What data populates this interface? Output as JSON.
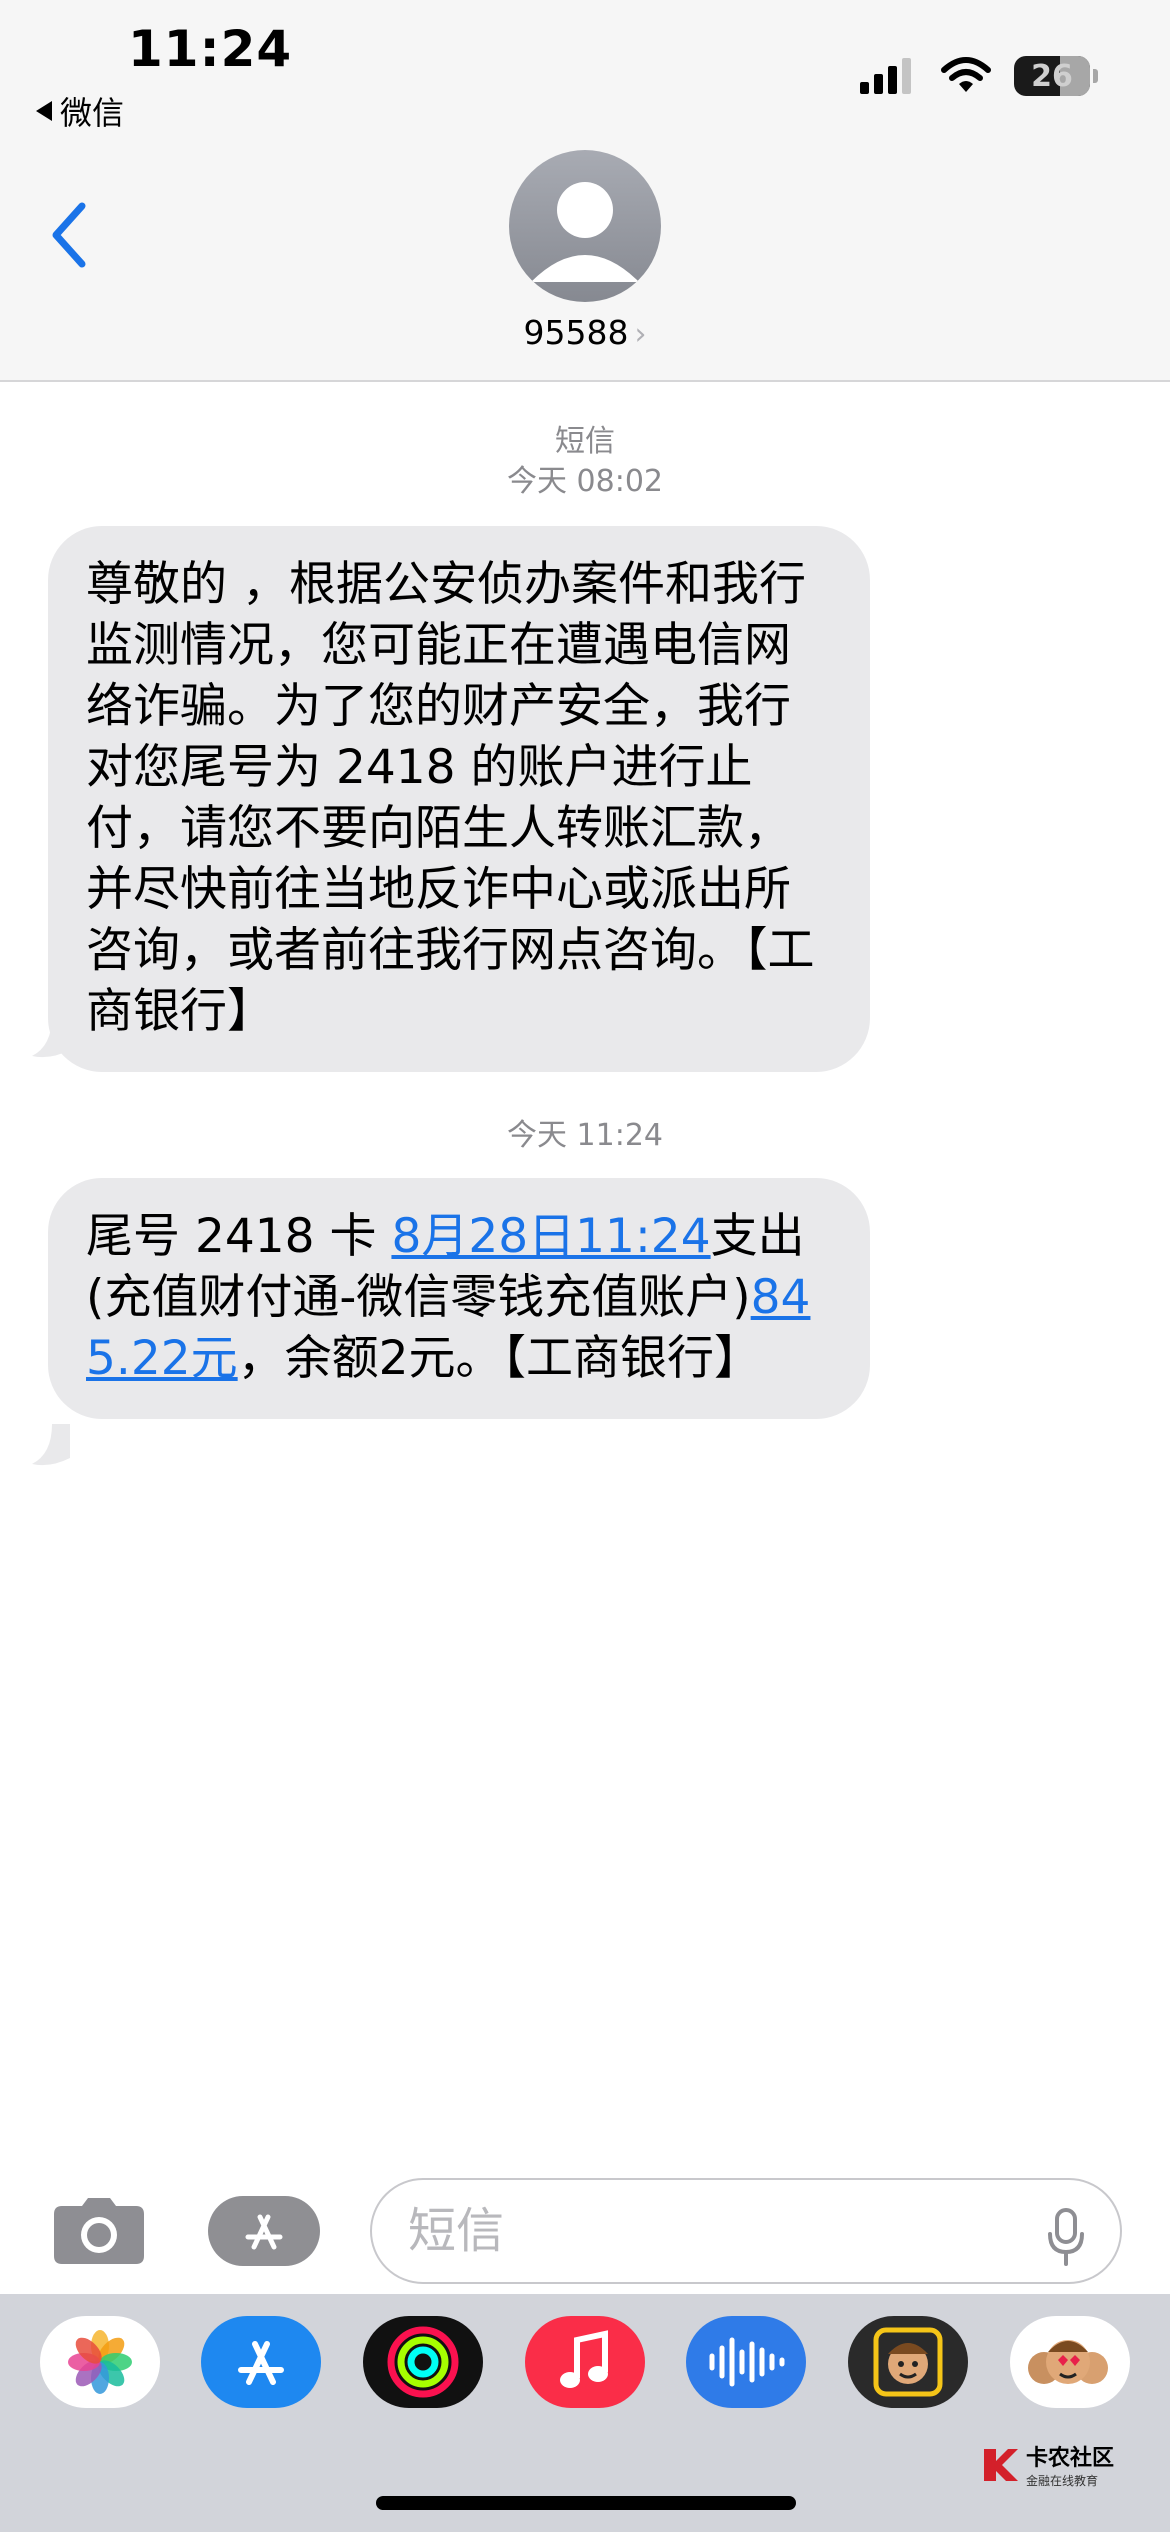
{
  "status_bar": {
    "time": "11:24",
    "back_app": "微信",
    "battery": "26"
  },
  "header": {
    "contact": "95588",
    "chevron": "›"
  },
  "messages": [
    {
      "service_label": "短信",
      "timestamp": "今天 08:02",
      "text": "尊敬的        ，根据公安侦办案件和我行监测情况，您可能正在遭遇电信网络诈骗。为了您的财产安全，我行对您尾号为 2418 的账户进行止付，请您不要向陌生人转账汇款，并尽快前往当地反诈中心或派出所咨询，或者前往我行网点咨询。【工商银行】"
    },
    {
      "timestamp": "今天 11:24",
      "part1": "尾号 2418 卡 ",
      "date_link": "8月28日11:24",
      "part2": "支出(充值财付通-微信零钱充值账户)",
      "amount_link": "845.22元",
      "part3": "，余额2元。【工商银行】"
    }
  ],
  "input": {
    "placeholder": "短信"
  },
  "watermark": {
    "title": "卡农社区",
    "subtitle": "金融在线教育"
  },
  "colors": {
    "accent": "#1a73e8",
    "bubble": "#e9e9eb",
    "header_bg": "#f6f6f6",
    "drawer_bg": "#d2d4da"
  }
}
